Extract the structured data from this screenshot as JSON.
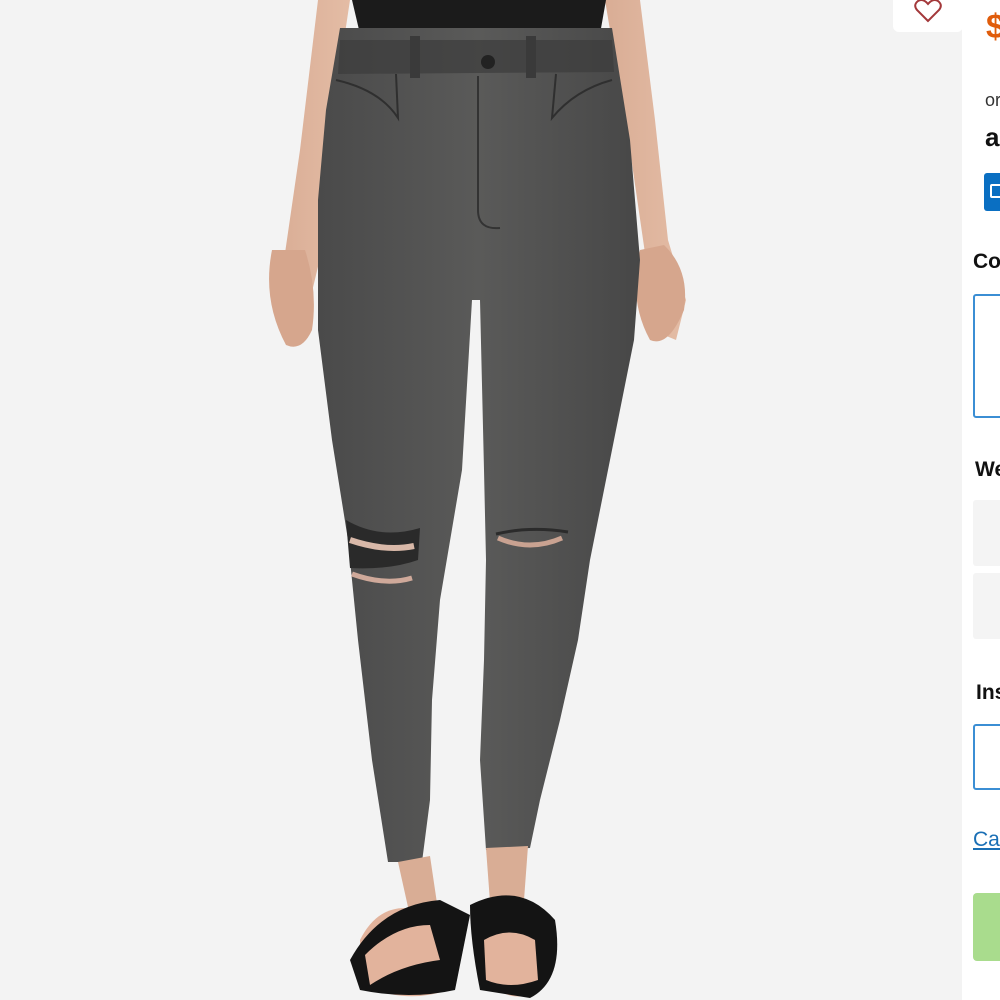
{
  "product": {
    "image_alt": "Skinny jeans, washed black with ripped knees",
    "price": "$",
    "favorite_icon": "heart-icon"
  },
  "purchase": {
    "installments_text": "or",
    "afterpay_text": "a",
    "afterpay_icon": "info-icon",
    "color_label": "Co",
    "waist_label": "We",
    "inseam_label": "Ins",
    "size_chart_link": "Car"
  },
  "colors": {
    "accent": "#3b8ed4",
    "price": "#e05c0b",
    "add_to_bag": "#a9dc8d",
    "link": "#1a6fb5"
  }
}
